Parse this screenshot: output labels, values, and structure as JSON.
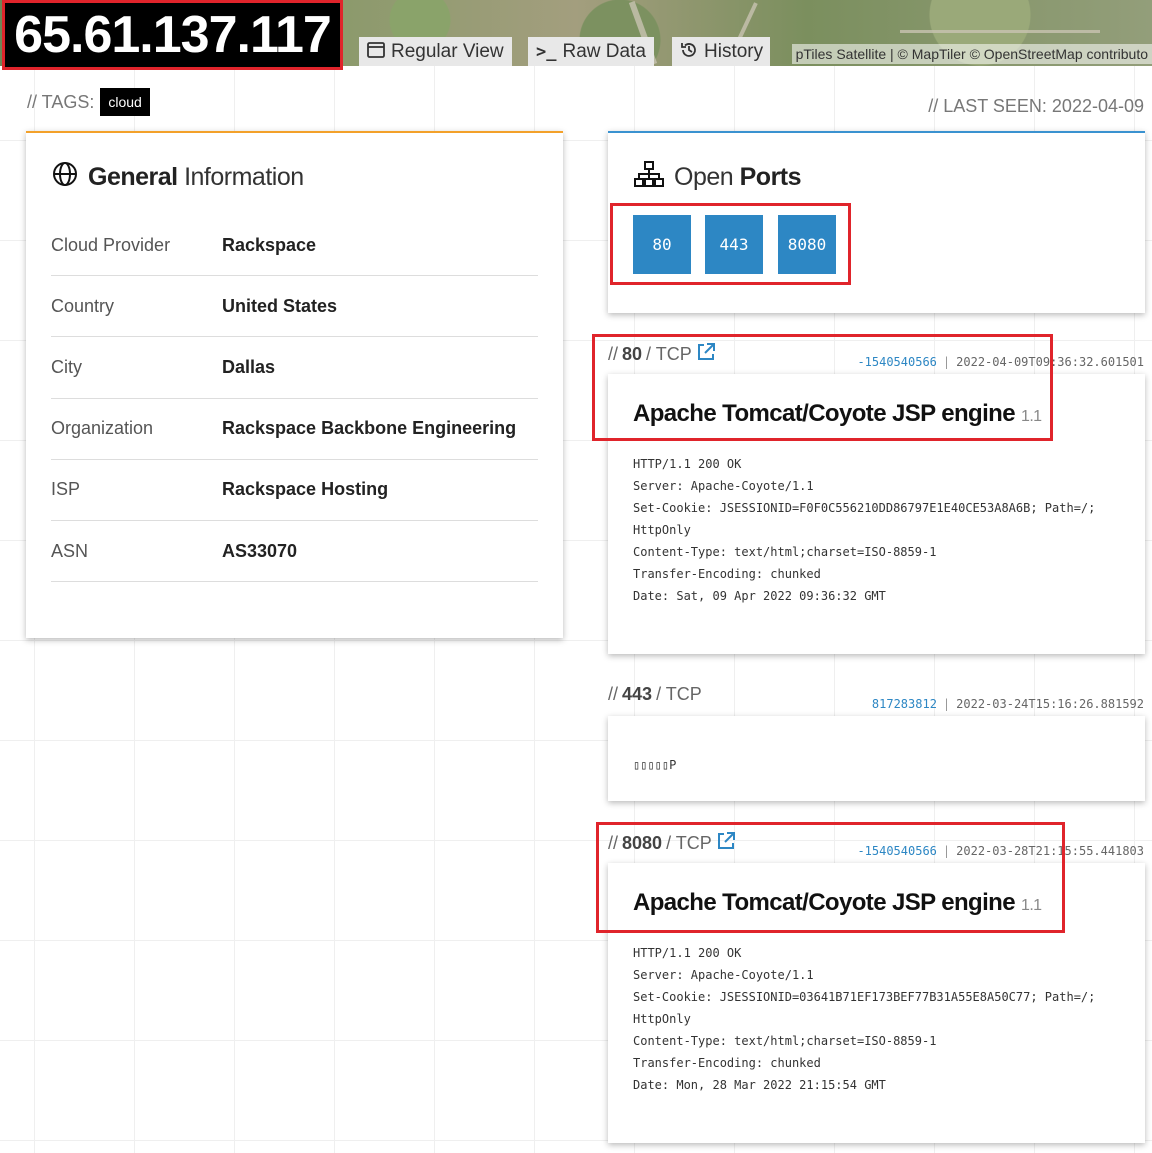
{
  "header": {
    "ip": "65.61.137.117",
    "tabs": [
      {
        "icon": "window-icon",
        "label": "Regular View"
      },
      {
        "icon": "terminal-icon",
        "label": "Raw Data"
      },
      {
        "icon": "history-icon",
        "label": "History"
      }
    ],
    "map_attribution": "pTiles Satellite | © MapTiler © OpenStreetMap contributo"
  },
  "tags": {
    "label": "// TAGS:",
    "items": [
      "cloud"
    ]
  },
  "last_seen": "// LAST SEEN: 2022-04-09",
  "general": {
    "title_strong": "General",
    "title_light": "Information",
    "rows": [
      {
        "key": "Cloud Provider",
        "value": "Rackspace"
      },
      {
        "key": "Country",
        "value": "United States"
      },
      {
        "key": "City",
        "value": "Dallas"
      },
      {
        "key": "Organization",
        "value": "Rackspace Backbone Engineering"
      },
      {
        "key": "ISP",
        "value": "Rackspace Hosting"
      },
      {
        "key": "ASN",
        "value": "AS33070"
      }
    ]
  },
  "ports": {
    "title_light": "Open",
    "title_strong": "Ports",
    "list": [
      "80",
      "443",
      "8080"
    ]
  },
  "services": [
    {
      "prefix": "//",
      "port": "80",
      "proto": "/ TCP",
      "hash": "-1540540566",
      "timestamp": "2022-04-09T09:36:32.601501",
      "product": "Apache Tomcat/Coyote JSP engine",
      "version": "1.1",
      "banner": "HTTP/1.1 200 OK\nServer: Apache-Coyote/1.1\nSet-Cookie: JSESSIONID=F0F0C556210DD86797E1E40CE53A8A6B; Path=/;\nHttpOnly\nContent-Type: text/html;charset=ISO-8859-1\nTransfer-Encoding: chunked\nDate: Sat, 09 Apr 2022 09:36:32 GMT"
    },
    {
      "prefix": "//",
      "port": "443",
      "proto": "/ TCP",
      "hash": "817283812",
      "timestamp": "2022-03-24T15:16:26.881592",
      "product": "",
      "version": "",
      "banner": "▯▯▯▯▯P"
    },
    {
      "prefix": "//",
      "port": "8080",
      "proto": "/ TCP",
      "hash": "-1540540566",
      "timestamp": "2022-03-28T21:15:55.441803",
      "product": "Apache Tomcat/Coyote JSP engine",
      "version": "1.1",
      "banner": "HTTP/1.1 200 OK\nServer: Apache-Coyote/1.1\nSet-Cookie: JSESSIONID=03641B71EF173BEF77B31A55E8A50C77; Path=/;\nHttpOnly\nContent-Type: text/html;charset=ISO-8859-1\nTransfer-Encoding: chunked\nDate: Mon, 28 Mar 2022 21:15:54 GMT"
    }
  ],
  "colors": {
    "highlight": "#e0242b",
    "port_button": "#2d87c4",
    "general_accent": "#f3a12a",
    "ports_accent": "#3a92d0"
  }
}
